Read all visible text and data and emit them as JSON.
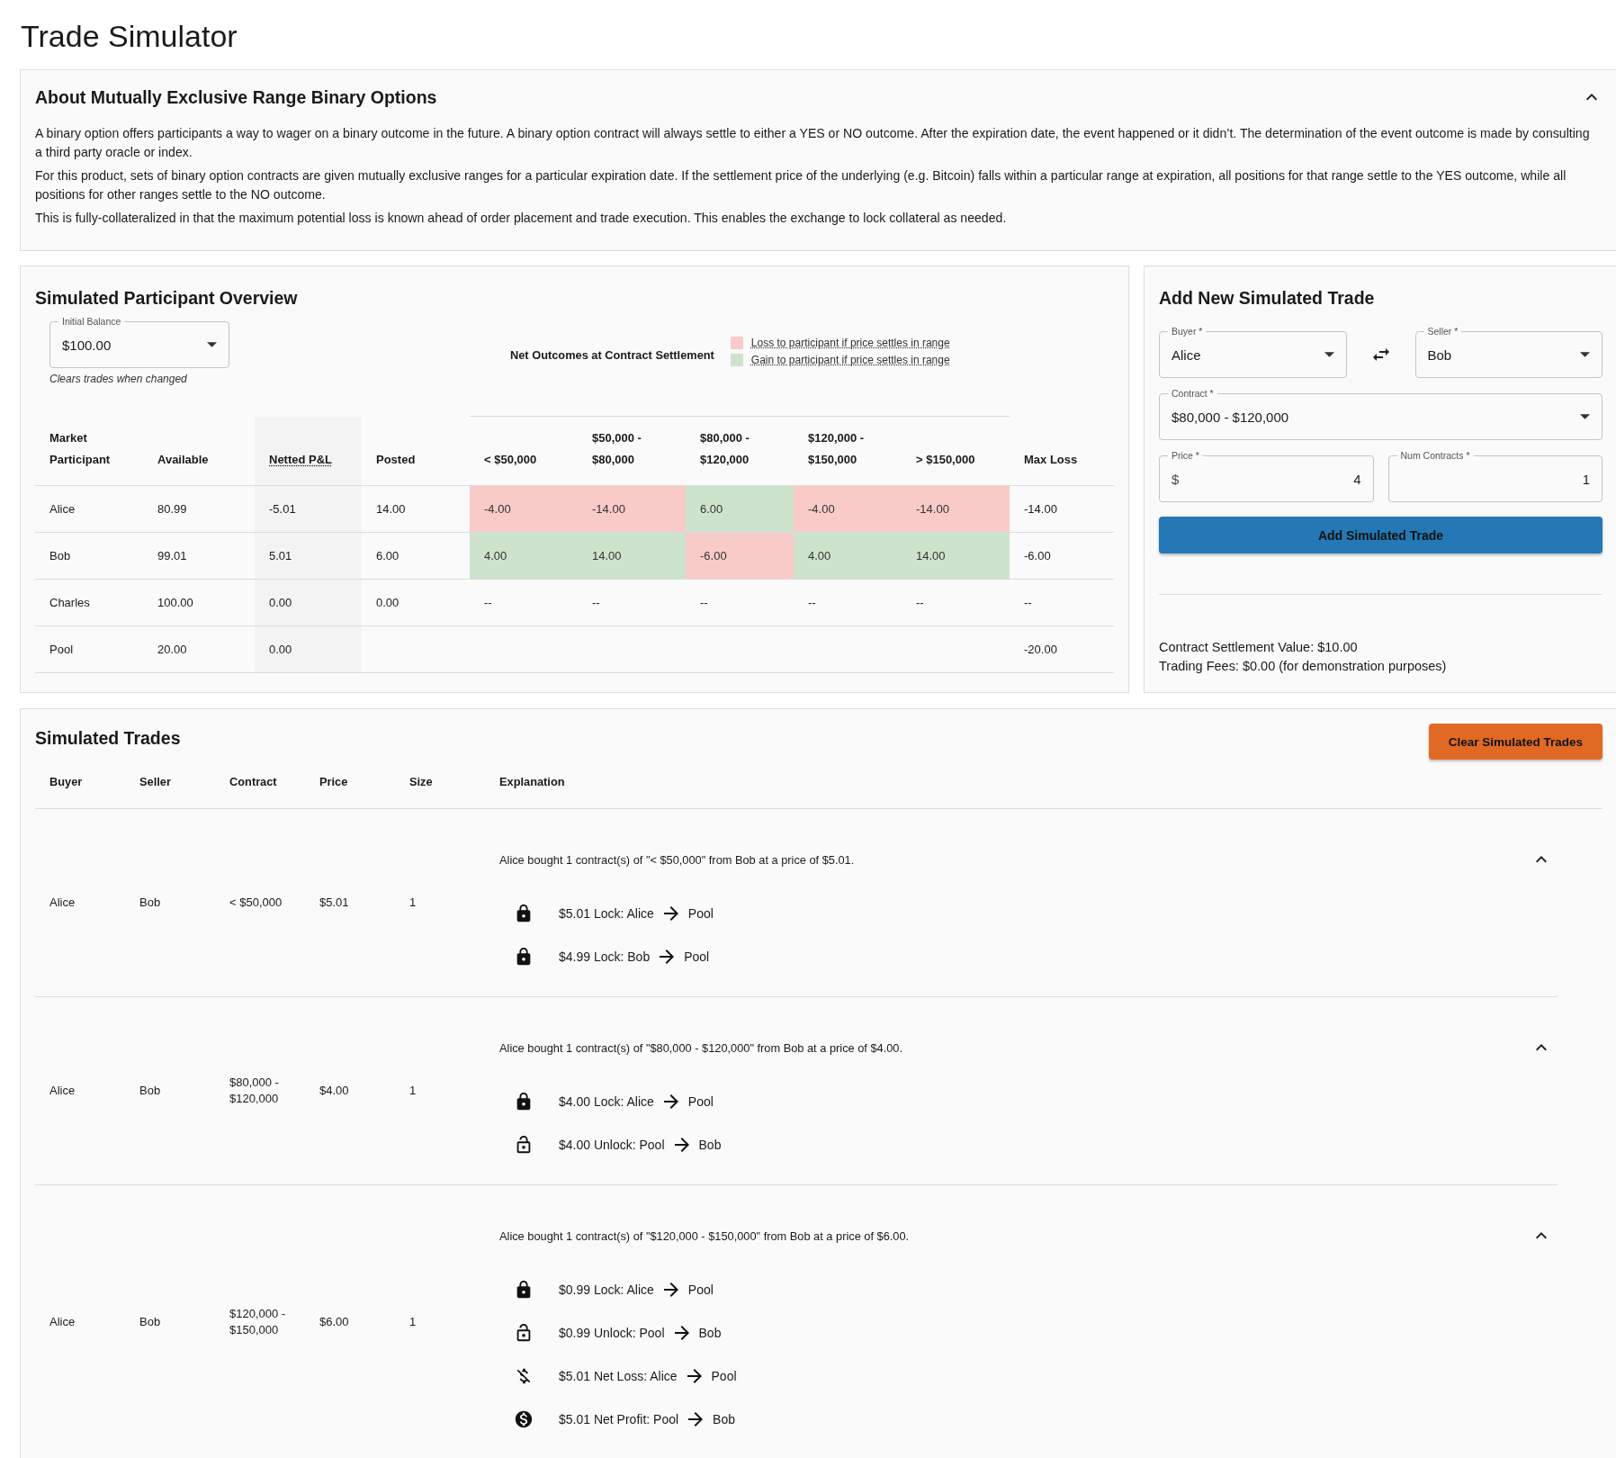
{
  "page_title": "Trade Simulator",
  "about": {
    "title": "About Mutually Exclusive Range Binary Options",
    "expanded": true,
    "paragraphs": [
      "A binary option offers participants a way to wager on a binary outcome in the future. A binary option contract will always settle to either a YES or NO outcome. After the expiration date, the event happened or it didn’t. The determination of the event outcome is made by consulting a third party oracle or index.",
      "For this product, sets of binary option contracts are given mutually exclusive ranges for a particular expiration date. If the settlement price of the underlying (e.g. Bitcoin) falls within a particular range at expiration, all positions for that range settle to the YES outcome, while all positions for other ranges settle to the NO outcome.",
      "This is fully-collateralized in that the maximum potential loss is known ahead of order placement and trade execution. This enables the exchange to lock collateral as needed."
    ]
  },
  "overview": {
    "title": "Simulated Participant Overview",
    "initial_balance": {
      "label": "Initial Balance",
      "value": "$100.00",
      "helper": "Clears trades when changed"
    },
    "outcomes_title": "Net Outcomes at Contract Settlement",
    "legend": [
      {
        "kind": "loss",
        "label": "Loss to participant if price settles in range",
        "color": "#f8cbc8"
      },
      {
        "kind": "gain",
        "label": "Gain to participant if price settles in range",
        "color": "#cde3cc"
      }
    ],
    "columns": [
      "Market Participant",
      "Available",
      "Netted P&L",
      "Posted"
    ],
    "range_columns": [
      "< $50,000",
      "$50,000 - $80,000",
      "$80,000 - $120,000",
      "$120,000 - $150,000",
      "> $150,000"
    ],
    "last_column": "Max Loss",
    "rows": [
      {
        "participant": "Alice",
        "available": "80.99",
        "netted": "-5.01",
        "posted": "14.00",
        "max_loss": "-14.00",
        "outcomes": [
          {
            "value": "-4.00",
            "kind": "loss"
          },
          {
            "value": "-14.00",
            "kind": "loss"
          },
          {
            "value": "6.00",
            "kind": "gain"
          },
          {
            "value": "-4.00",
            "kind": "loss"
          },
          {
            "value": "-14.00",
            "kind": "loss"
          }
        ]
      },
      {
        "participant": "Bob",
        "available": "99.01",
        "netted": "5.01",
        "posted": "6.00",
        "max_loss": "-6.00",
        "outcomes": [
          {
            "value": "4.00",
            "kind": "gain"
          },
          {
            "value": "14.00",
            "kind": "gain"
          },
          {
            "value": "-6.00",
            "kind": "loss"
          },
          {
            "value": "4.00",
            "kind": "gain"
          },
          {
            "value": "14.00",
            "kind": "gain"
          }
        ]
      },
      {
        "participant": "Charles",
        "available": "100.00",
        "netted": "0.00",
        "posted": "0.00",
        "max_loss": "--",
        "outcomes": [
          {
            "value": "--",
            "kind": "none"
          },
          {
            "value": "--",
            "kind": "none"
          },
          {
            "value": "--",
            "kind": "none"
          },
          {
            "value": "--",
            "kind": "none"
          },
          {
            "value": "--",
            "kind": "none"
          }
        ]
      },
      {
        "participant": "Pool",
        "available": "20.00",
        "netted": "0.00",
        "max_loss": "-20.00"
      }
    ]
  },
  "add_trade": {
    "title": "Add New Simulated Trade",
    "buyer": {
      "label": "Buyer *",
      "value": "Alice"
    },
    "seller": {
      "label": "Seller *",
      "value": "Bob"
    },
    "contract": {
      "label": "Contract *",
      "value": "$80,000 - $120,000"
    },
    "price": {
      "label": "Price *",
      "prefix": "$",
      "value": "4"
    },
    "num_contracts": {
      "label": "Num Contracts *",
      "value": "1"
    },
    "button": "Add Simulated Trade",
    "info": [
      "Contract Settlement Value: $10.00",
      "Trading Fees: $0.00 (for demonstration purposes)"
    ]
  },
  "trades": {
    "title": "Simulated Trades",
    "clear_button": "Clear Simulated Trades",
    "columns": [
      "Buyer",
      "Seller",
      "Contract",
      "Price",
      "Size",
      "Explanation"
    ],
    "rows": [
      {
        "buyer": "Alice",
        "seller": "Bob",
        "contract": "< $50,000",
        "price": "$5.01",
        "size": "1",
        "expanded": true,
        "explanation": "Alice bought 1 contract(s) of \"< $50,000\" from Bob at a price of $5.01.",
        "steps": [
          {
            "kind": "lock",
            "text": "$5.01 Lock: Alice",
            "to": "Pool"
          },
          {
            "kind": "lock",
            "text": "$4.99 Lock: Bob",
            "to": "Pool"
          }
        ]
      },
      {
        "buyer": "Alice",
        "seller": "Bob",
        "contract": "$80,000 - $120,000",
        "price": "$4.00",
        "size": "1",
        "expanded": true,
        "explanation": "Alice bought 1 contract(s) of \"$80,000 - $120,000\" from Bob at a price of $4.00.",
        "steps": [
          {
            "kind": "lock",
            "text": "$4.00 Lock: Alice",
            "to": "Pool"
          },
          {
            "kind": "unlock",
            "text": "$4.00 Unlock: Pool",
            "to": "Bob"
          }
        ]
      },
      {
        "buyer": "Alice",
        "seller": "Bob",
        "contract": "$120,000 - $150,000",
        "price": "$6.00",
        "size": "1",
        "expanded": true,
        "explanation": "Alice bought 1 contract(s) of \"$120,000 - $150,000\" from Bob at a price of $6.00.",
        "steps": [
          {
            "kind": "lock",
            "text": "$0.99 Lock: Alice",
            "to": "Pool"
          },
          {
            "kind": "unlock",
            "text": "$0.99 Unlock: Pool",
            "to": "Bob"
          },
          {
            "kind": "loss",
            "text": "$5.01 Net Loss: Alice",
            "to": "Pool"
          },
          {
            "kind": "profit",
            "text": "$5.01 Net Profit: Pool",
            "to": "Bob"
          }
        ]
      }
    ]
  }
}
